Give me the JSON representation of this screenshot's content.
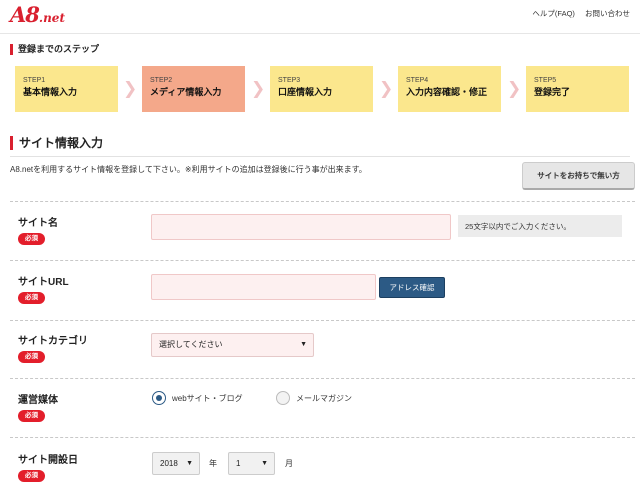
{
  "header": {
    "logo_main": "A8",
    "logo_suffix": ".net",
    "links": [
      "ヘルプ(FAQ)",
      "お問い合わせ"
    ]
  },
  "steps": {
    "label": "登録までのステップ",
    "items": [
      {
        "num": "STEP1",
        "name": "基本情報入力"
      },
      {
        "num": "STEP2",
        "name": "メディア情報入力"
      },
      {
        "num": "STEP3",
        "name": "口座情報入力"
      },
      {
        "num": "STEP4",
        "name": "入力内容確認・修正"
      },
      {
        "num": "STEP5",
        "name": "登録完了"
      }
    ],
    "active_index": 1
  },
  "section": {
    "title": "サイト情報入力",
    "intro": "A8.netを利用するサイト情報を登録して下さい。※利用サイトの追加は登録後に行う事が出来ます。",
    "no_site_button": "サイトをお持ちで無い方"
  },
  "form": {
    "required_label": "必須",
    "site_name": {
      "label": "サイト名",
      "value": "",
      "hint": "25文字以内でご入力ください。"
    },
    "site_url": {
      "label": "サイトURL",
      "value": "",
      "check_button": "アドレス確認"
    },
    "site_category": {
      "label": "サイトカテゴリ",
      "selected": "選択してください"
    },
    "media": {
      "label": "運営媒体",
      "options": [
        "webサイト・ブログ",
        "メールマガジン"
      ],
      "selected_index": 0
    },
    "opened": {
      "label": "サイト開設日",
      "year": "2018",
      "year_unit": "年",
      "month": "1",
      "month_unit": "月"
    }
  },
  "colors": {
    "brand": "#d9202f",
    "step": "#fbe78d",
    "step_active": "#f4a88a",
    "button_blue": "#2c5a85"
  }
}
